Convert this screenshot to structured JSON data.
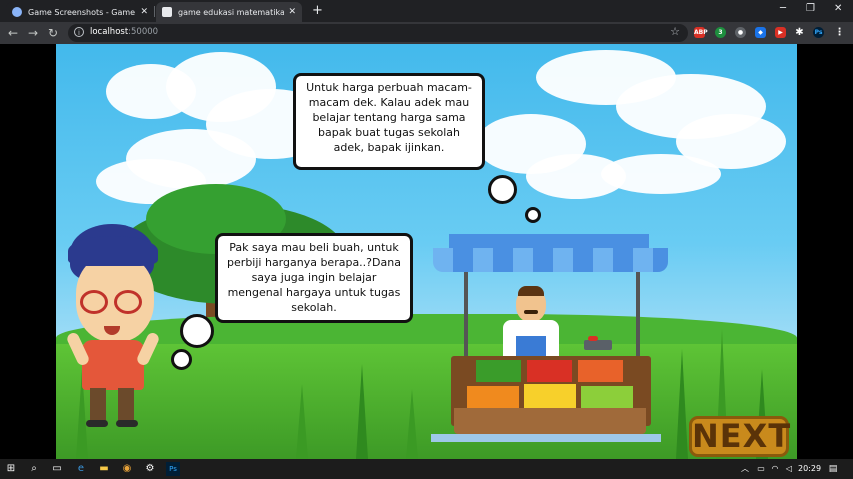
{
  "browser": {
    "tabs": [
      {
        "title": "Game Screenshots - Game Eduka",
        "favicon_color": "#8ab4f8"
      },
      {
        "title": "game edukasi matematika (Cons",
        "favicon_color": "#e8eaed"
      }
    ],
    "new_tab_symbol": "+",
    "close_symbol": "✕",
    "url_host": "localhost",
    "url_port": ":50000",
    "extensions": [
      {
        "label": "ABP",
        "color": "#d93025"
      },
      {
        "label": "3",
        "color": "#1e8e3e"
      },
      {
        "label": "●",
        "color": "#5f6368"
      },
      {
        "label": "◆",
        "color": "#1a73e8"
      },
      {
        "label": "▶",
        "color": "#d93025"
      },
      {
        "label": "Ps",
        "color": "#001e36"
      }
    ]
  },
  "game": {
    "seller_speech": "Untuk harga perbuah macam-macam dek. Kalau adek mau belajar tentang harga sama bapak buat tugas sekolah adek, bapak ijinkan.",
    "boy_speech": "Pak saya mau beli buah, untuk perbiji harganya berapa..?Dana saya juga ingin belajar mengenal hargaya untuk tugas sekolah.",
    "next_label": "NEXT"
  },
  "taskbar": {
    "time": "20:29"
  }
}
